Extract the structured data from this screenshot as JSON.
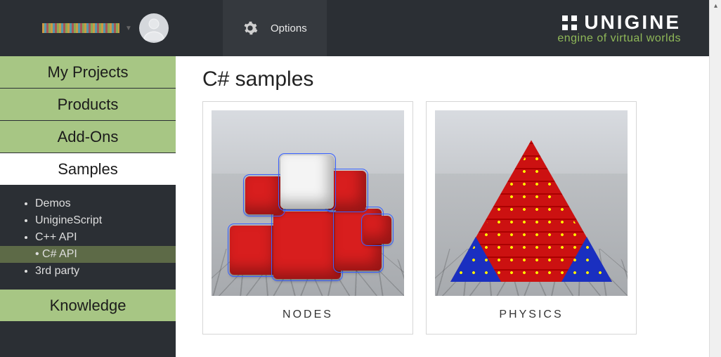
{
  "header": {
    "options_label": "Options",
    "brand_name": "UNIGINE",
    "brand_tagline": "engine of virtual worlds"
  },
  "sidebar": {
    "items": [
      {
        "label": "My Projects",
        "active": false
      },
      {
        "label": "Products",
        "active": false
      },
      {
        "label": "Add-Ons",
        "active": false
      },
      {
        "label": "Samples",
        "active": true
      },
      {
        "label": "Knowledge",
        "active": false
      }
    ],
    "samples_sub": [
      {
        "label": "Demos",
        "selected": false
      },
      {
        "label": "UnigineScript",
        "selected": false
      },
      {
        "label": "C++ API",
        "selected": false
      },
      {
        "label": "C# API",
        "selected": true
      },
      {
        "label": "3rd party",
        "selected": false
      }
    ]
  },
  "content": {
    "title": "C# samples",
    "cards": [
      {
        "label": "NODES"
      },
      {
        "label": "PHYSICS"
      }
    ]
  }
}
